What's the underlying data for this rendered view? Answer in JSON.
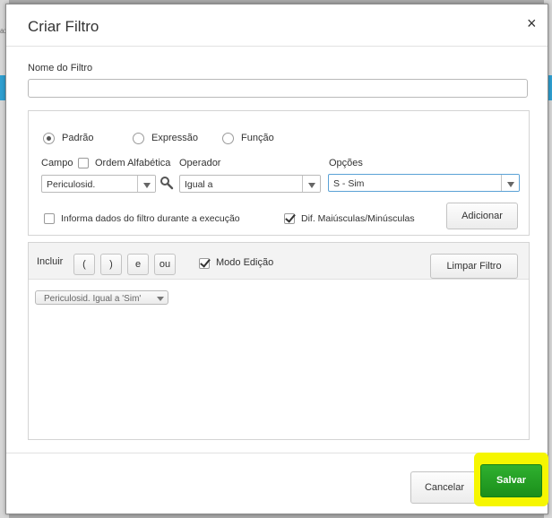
{
  "dialog": {
    "title": "Criar Filtro",
    "close_glyph": "×",
    "name_label": "Nome do Filtro",
    "name_value": "",
    "type_options": [
      "Padrão",
      "Expressão",
      "Função"
    ],
    "type_selected": "Padrão",
    "campo_label": "Campo",
    "ordem_label": "Ordem Alfabética",
    "ordem_checked": false,
    "campo_value": "Periculosid.",
    "operador_label": "Operador",
    "operador_value": "Igual a",
    "opcoes_label": "Opções",
    "opcoes_value": "S - Sim",
    "informa_label": "Informa dados do filtro durante a execução",
    "informa_checked": false,
    "dif_label": "Dif. Maiúsculas/Minúsculas",
    "dif_checked": true,
    "adicionar_label": "Adicionar",
    "incluir_label": "Incluir",
    "operator_buttons": [
      "(",
      ")",
      "e",
      "ou"
    ],
    "modo_label": "Modo Edição",
    "modo_checked": true,
    "limpar_label": "Limpar Filtro",
    "expression_tag": "Periculosid. Igual a 'Sim'",
    "cancel_label": "Cancelar",
    "save_label": "Salvar"
  },
  "background": {
    "edge_text": "a:"
  },
  "colors": {
    "highlight": "#f6f600",
    "save_button": "#1f9a1f",
    "app_blue": "#2f9fd0"
  },
  "icons": {
    "search": "magnifier-icon",
    "close": "close-icon",
    "dropdown": "chevron-down-icon"
  }
}
